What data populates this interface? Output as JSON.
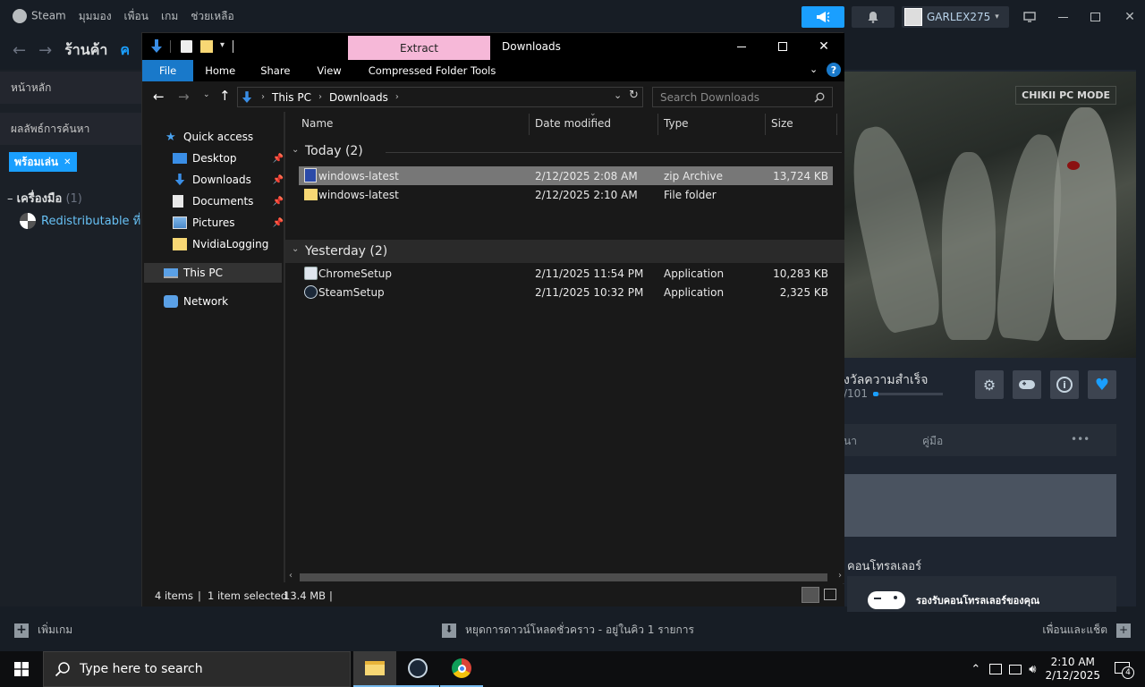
{
  "steam": {
    "menu": [
      "Steam",
      "มุมมอง",
      "เพื่อน",
      "เกม",
      "ช่วยเหลือ"
    ],
    "username": "GARLEX275",
    "nav_title": "ร้านค้า",
    "nav_partial": "ค",
    "sidebar": {
      "home": "หน้าหลัก",
      "search_results": "ผลลัพธ์การค้นหา",
      "filter_chip": "พร้อมเล่น",
      "tools_heading": "เครื่องมือ",
      "tools_count": "(1)",
      "tool_item": "Redistributable ที่"
    },
    "right_panel": {
      "mode_badge": "CHIKII PC MODE",
      "achievements": "งวัลความสำเร็จ",
      "achievements_progress": "/101",
      "tab_partial": "นา",
      "guide_tab": "คู่มือ",
      "more": "•••",
      "controller_heading": "คอนโทรลเลอร์",
      "controller_support": "รองรับคอนโทรลเลอร์ของคุณ"
    },
    "bottom": {
      "add_game": "เพิ่มเกม",
      "downloads": "หยุดการดาวน์โหลดชั่วคราว - อยู่ในคิว 1 รายการ",
      "friends_chat": "เพื่อนและแช็ต"
    }
  },
  "explorer": {
    "context_tab": "Extract",
    "window_title": "Downloads",
    "ribbon_tabs": [
      "File",
      "Home",
      "Share",
      "View",
      "Compressed Folder Tools"
    ],
    "breadcrumb": [
      "This PC",
      "Downloads"
    ],
    "search_placeholder": "Search Downloads",
    "nav": {
      "quick_access": "Quick access",
      "desktop": "Desktop",
      "downloads": "Downloads",
      "documents": "Documents",
      "pictures": "Pictures",
      "nvidia": "NvidiaLogging",
      "this_pc": "This PC",
      "network": "Network"
    },
    "columns": {
      "name": "Name",
      "date": "Date modified",
      "type": "Type",
      "size": "Size"
    },
    "groups": {
      "today": "Today (2)",
      "yesterday": "Yesterday (2)"
    },
    "files_today": [
      {
        "name": "windows-latest",
        "date": "2/12/2025 2:08 AM",
        "type": "zip Archive",
        "size": "13,724 KB",
        "icon": "zip-icon",
        "selected": true
      },
      {
        "name": "windows-latest",
        "date": "2/12/2025 2:10 AM",
        "type": "File folder",
        "size": "",
        "icon": "folder-icon",
        "selected": false
      }
    ],
    "files_yesterday": [
      {
        "name": "ChromeSetup",
        "date": "2/11/2025 11:54 PM",
        "type": "Application",
        "size": "10,283 KB",
        "icon": "installer-icon"
      },
      {
        "name": "SteamSetup",
        "date": "2/11/2025 10:32 PM",
        "type": "Application",
        "size": "2,325 KB",
        "icon": "steam-icon"
      }
    ],
    "status": {
      "count": "4 items",
      "selected": "1 item selected",
      "size": "13.4 MB"
    }
  },
  "taskbar": {
    "search_placeholder": "Type here to search",
    "time": "2:10 AM",
    "date": "2/12/2025",
    "notifications": "4"
  },
  "colors": {
    "accent": "#1a9fff",
    "steam_bg": "#171d25",
    "explorer_bg": "#191919",
    "extract_tab": "#f6b8d8",
    "selected_row": "#777777"
  }
}
